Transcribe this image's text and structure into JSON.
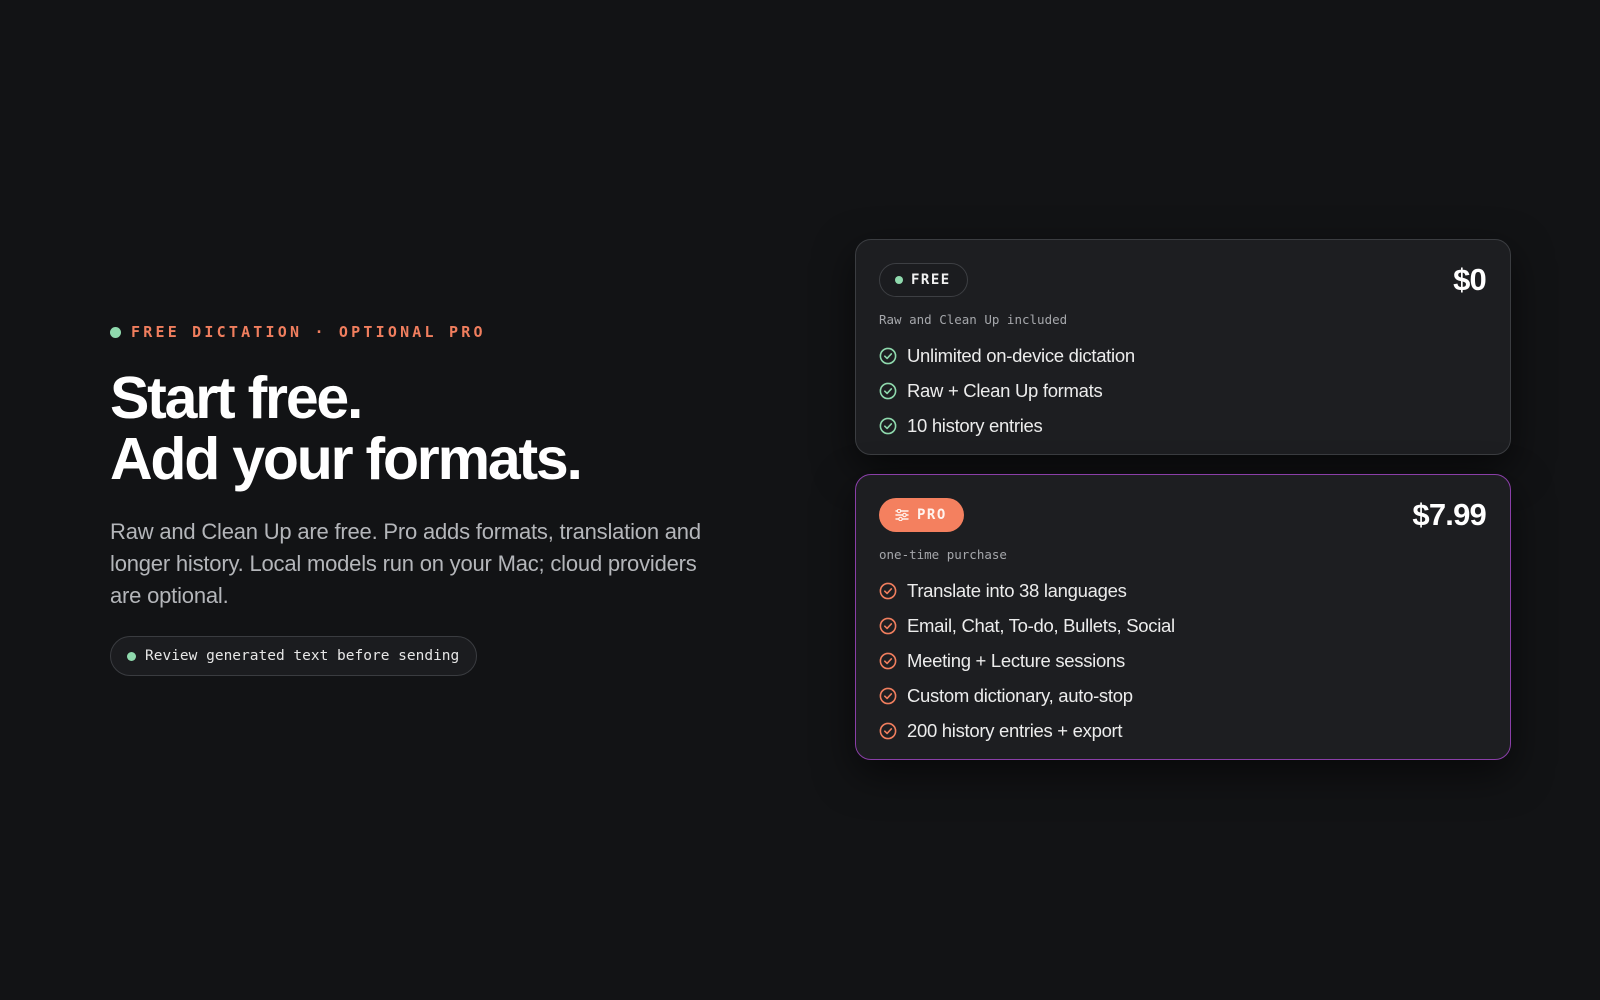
{
  "hero": {
    "eyebrow": "FREE DICTATION · OPTIONAL PRO",
    "headline_line1": "Start free.",
    "headline_line2": "Add your formats.",
    "lede": "Raw and Clean Up are free. Pro adds formats, translation and longer history. Local models run on your Mac; cloud providers are optional.",
    "note": "Review generated text before sending"
  },
  "plans": {
    "free": {
      "badge": "FREE",
      "price": "$0",
      "subtitle": "Raw and Clean Up included",
      "features": [
        "Unlimited on-device dictation",
        "Raw + Clean Up formats",
        "10 history entries"
      ]
    },
    "pro": {
      "badge": "PRO",
      "price": "$7.99",
      "subtitle": "one-time purchase",
      "features": [
        "Translate into 38 languages",
        "Email, Chat, To-do, Bullets, Social",
        "Meeting + Lecture sessions",
        "Custom dictionary, auto-stop",
        "200 history entries + export"
      ]
    }
  },
  "icons": {
    "status_dot": "status-dot",
    "free_check": "check-circle-icon",
    "pro_check": "check-circle-icon",
    "pro_badge": "sliders-icon"
  },
  "colors": {
    "background": "#121315",
    "accent_orange": "#f07e5e",
    "accent_green": "#8fd9ad",
    "pro_border": "#8a3fa8",
    "pro_badge": "#f4805f"
  }
}
